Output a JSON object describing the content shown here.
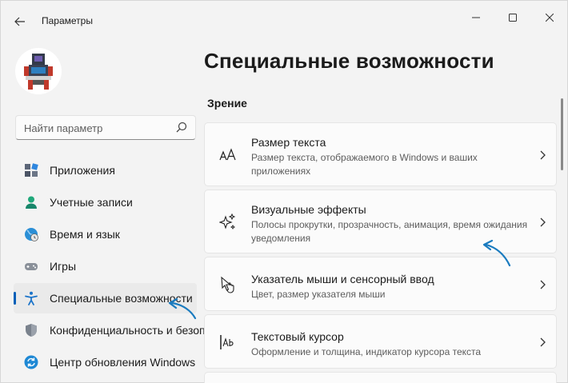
{
  "window": {
    "title": "Параметры",
    "controls": {
      "minimize": "minimize-icon",
      "maximize": "maximize-icon",
      "close": "close-icon"
    }
  },
  "search": {
    "placeholder": "Найти параметр",
    "value": ""
  },
  "sidebar": {
    "items": [
      {
        "label": "Приложения",
        "icon": "apps-icon",
        "active": false
      },
      {
        "label": "Учетные записи",
        "icon": "accounts-icon",
        "active": false
      },
      {
        "label": "Время и язык",
        "icon": "time-language-icon",
        "active": false
      },
      {
        "label": "Игры",
        "icon": "gaming-icon",
        "active": false
      },
      {
        "label": "Специальные возможности",
        "icon": "accessibility-icon",
        "active": true
      },
      {
        "label": "Конфиденциальность и безопасность",
        "icon": "privacy-shield-icon",
        "active": false
      },
      {
        "label": "Центр обновления Windows",
        "icon": "windows-update-icon",
        "active": false
      }
    ]
  },
  "main": {
    "title": "Специальные возможности",
    "section": "Зрение",
    "cards": [
      {
        "title": "Размер текста",
        "description": "Размер текста, отображаемого в Windows и ваших приложениях",
        "icon": "text-size-icon"
      },
      {
        "title": "Визуальные эффекты",
        "description": "Полосы прокрутки, прозрачность, анимация, время ожидания уведомления",
        "icon": "sparkle-icon"
      },
      {
        "title": "Указатель мыши и сенсорный ввод",
        "description": "Цвет, размер указателя мыши",
        "icon": "mouse-pointer-icon"
      },
      {
        "title": "Текстовый курсор",
        "description": "Оформление и толщина, индикатор курсора текста",
        "icon": "text-cursor-icon"
      }
    ]
  },
  "colors": {
    "accent": "#005fb8",
    "arrow": "#1a7bbf",
    "background": "#f3f3f3",
    "card": "#fbfbfb"
  }
}
